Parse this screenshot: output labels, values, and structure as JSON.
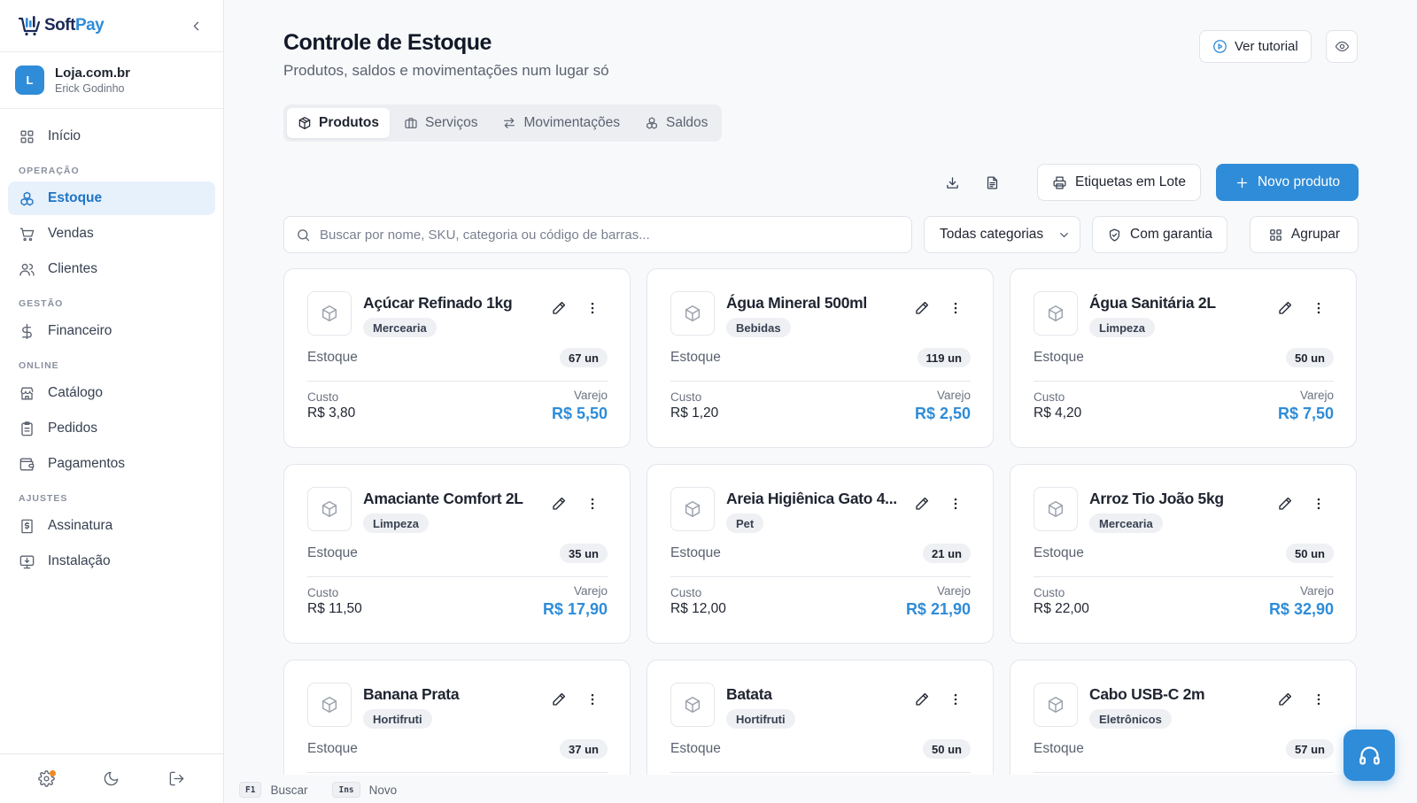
{
  "brand": {
    "soft": "Soft",
    "pay": "Pay"
  },
  "store": {
    "initial": "L",
    "name": "Loja.com.br",
    "user": "Erick Godinho"
  },
  "nav": {
    "inicio": "Início",
    "section_operacao": "OPERAÇÃO",
    "estoque": "Estoque",
    "vendas": "Vendas",
    "clientes": "Clientes",
    "section_gestao": "GESTÃO",
    "financeiro": "Financeiro",
    "section_online": "ONLINE",
    "catalogo": "Catálogo",
    "pedidos": "Pedidos",
    "pagamentos": "Pagamentos",
    "section_ajustes": "AJUSTES",
    "assinatura": "Assinatura",
    "instalacao": "Instalação"
  },
  "header": {
    "title": "Controle de Estoque",
    "subtitle": "Produtos, saldos e movimentações num lugar só",
    "tutorial": "Ver tutorial"
  },
  "tabs": [
    {
      "label": "Produtos",
      "active": true
    },
    {
      "label": "Serviços"
    },
    {
      "label": "Movimentações"
    },
    {
      "label": "Saldos"
    }
  ],
  "toolbar": {
    "labels_batch": "Etiquetas em Lote",
    "new_product": "Novo produto"
  },
  "filters": {
    "search_placeholder": "Buscar por nome, SKU, categoria ou código de barras...",
    "category": "Todas categorias",
    "warranty": "Com garantia",
    "group": "Agrupar"
  },
  "card_labels": {
    "stock": "Estoque",
    "cost": "Custo",
    "retail": "Varejo"
  },
  "products": [
    {
      "name": "Açúcar Refinado 1kg",
      "category": "Mercearia",
      "stock": "67 un",
      "cost": "R$ 3,80",
      "retail": "R$ 5,50"
    },
    {
      "name": "Água Mineral 500ml",
      "category": "Bebidas",
      "stock": "119 un",
      "cost": "R$ 1,20",
      "retail": "R$ 2,50"
    },
    {
      "name": "Água Sanitária 2L",
      "category": "Limpeza",
      "stock": "50 un",
      "cost": "R$ 4,20",
      "retail": "R$ 7,50"
    },
    {
      "name": "Amaciante Comfort 2L",
      "category": "Limpeza",
      "stock": "35 un",
      "cost": "R$ 11,50",
      "retail": "R$ 17,90"
    },
    {
      "name": "Areia Higiênica Gato 4...",
      "category": "Pet",
      "stock": "21 un",
      "cost": "R$ 12,00",
      "retail": "R$ 21,90"
    },
    {
      "name": "Arroz Tio João 5kg",
      "category": "Mercearia",
      "stock": "50 un",
      "cost": "R$ 22,00",
      "retail": "R$ 32,90"
    },
    {
      "name": "Banana Prata",
      "category": "Hortifruti",
      "stock": "37 un",
      "cost": "",
      "retail": ""
    },
    {
      "name": "Batata",
      "category": "Hortifruti",
      "stock": "50 un",
      "cost": "",
      "retail": ""
    },
    {
      "name": "Cabo USB-C 2m",
      "category": "Eletrônicos",
      "stock": "57 un",
      "cost": "",
      "retail": ""
    }
  ],
  "shortcuts": [
    {
      "key": "F1",
      "label": "Buscar"
    },
    {
      "key": "Ins",
      "label": "Novo"
    }
  ],
  "colors": {
    "accent": "#2f8cd8",
    "active_bg": "#e6f1fc",
    "notification_dot": "#f08a24"
  },
  "icons": {
    "inicio": "grid-icon",
    "estoque": "boxes-icon",
    "vendas": "cart-icon",
    "clientes": "users-icon",
    "financeiro": "dollar-icon",
    "catalogo": "store-icon",
    "pedidos": "clipboard-icon",
    "pagamentos": "wallet-icon",
    "assinatura": "receipt-icon",
    "instalacao": "monitor-download-icon"
  }
}
